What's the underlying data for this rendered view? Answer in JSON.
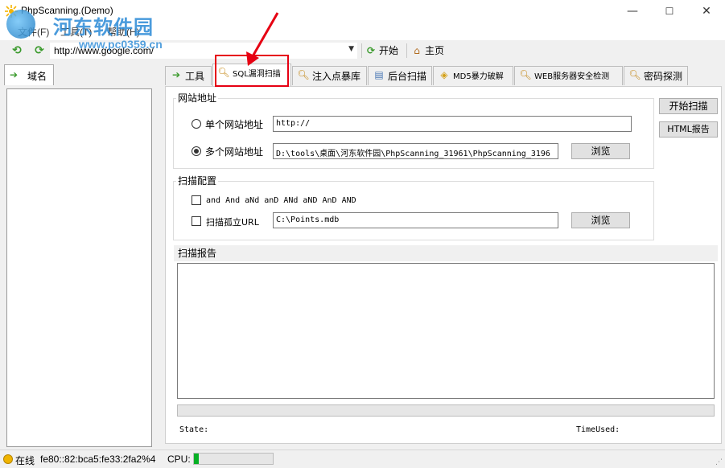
{
  "window": {
    "title": "PhpScanning.(Demo)",
    "controls": {
      "minimize": "—",
      "maximize": "☐",
      "close": "✕"
    }
  },
  "menu": {
    "items": [
      "文件(F)",
      "工具(T)",
      "帮助(H)"
    ]
  },
  "watermark": {
    "text": "河东软件园",
    "url": "www.pc0359.cn"
  },
  "toolbar": {
    "url": "http://www.google.com/",
    "start_label": "开始",
    "home_label": "主页"
  },
  "left_tab": {
    "label": "域名"
  },
  "tabs": [
    {
      "label": "工具",
      "icon": "arrow-icon"
    },
    {
      "label": "SQL漏洞扫描",
      "icon": "search-icon"
    },
    {
      "label": "注入点暴库",
      "icon": "search-icon"
    },
    {
      "label": "后台扫描",
      "icon": "database-icon"
    },
    {
      "label": "MD5暴力破解",
      "icon": "box-icon"
    },
    {
      "label": "WEB服务器安全检测",
      "icon": "search-icon"
    },
    {
      "label": "密码探测",
      "icon": "search-icon"
    }
  ],
  "site_group": {
    "title": "网站地址",
    "single_label": "单个网站地址",
    "single_value": "http://",
    "multi_label": "多个网站地址",
    "multi_value": "D:\\tools\\桌面\\河东软件园\\PhpScanning_31961\\PhpScanning_3196",
    "browse_label": "浏览",
    "selected": "multi"
  },
  "actions": {
    "start_scan": "开始扫描",
    "html_report": "HTML报告"
  },
  "config_group": {
    "title": "扫描配置",
    "and_label": "and And aNd anD ANd aND AnD AND",
    "isolated_label": "扫描孤立URL",
    "isolated_value": "C:\\Points.mdb",
    "browse_label": "浏览"
  },
  "report": {
    "title": "扫描报告",
    "state_label": "State:",
    "timeused_label": "TimeUsed:"
  },
  "statusbar": {
    "status": "在线",
    "address": "fe80::82:bca5:fe33:2fa2%4",
    "cpu_label": "CPU:",
    "cpu_fraction": 0.06
  }
}
